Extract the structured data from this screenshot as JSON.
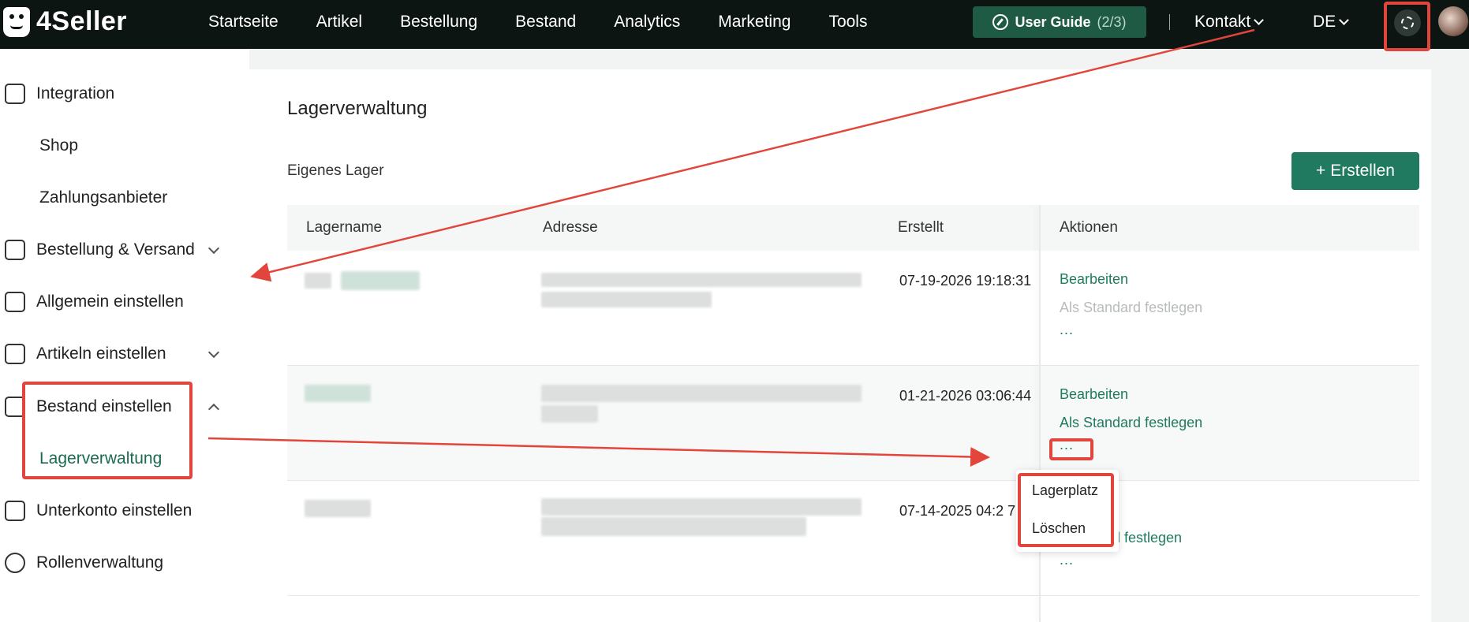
{
  "app": {
    "logo_text": "4Seller"
  },
  "nav": {
    "items": [
      "Startseite",
      "Artikel",
      "Bestellung",
      "Bestand",
      "Analytics",
      "Marketing",
      "Tools"
    ],
    "user_guide_label": "User Guide",
    "user_guide_count": "(2/3)",
    "kontakt_label": "Kontakt",
    "language": "DE"
  },
  "sidebar": {
    "integration": "Integration",
    "shop": "Shop",
    "zahlungsanbieter": "Zahlungsanbieter",
    "bestellung_versand": "Bestellung & Versand",
    "allgemein": "Allgemein einstellen",
    "artikeln": "Artikeln einstellen",
    "bestand": "Bestand einstellen",
    "lagerverwaltung": "Lagerverwaltung",
    "unterkonto": "Unterkonto einstellen",
    "rollen": "Rollenverwaltung"
  },
  "main": {
    "title": "Lagerverwaltung",
    "section_label": "Eigenes Lager",
    "create_button": "Erstellen",
    "columns": [
      "Lagername",
      "Adresse",
      "Erstellt",
      "Aktionen"
    ],
    "rows": [
      {
        "created": "07-19-2026 19:18:31",
        "edit": "Bearbeiten",
        "set_default": "Als Standard festlegen",
        "more": "..."
      },
      {
        "created": "01-21-2026 03:06:44",
        "edit": "Bearbeiten",
        "set_default": "Als Standard festlegen",
        "more": "..."
      },
      {
        "created": "07-14-2025 04:2 7",
        "edit": "en",
        "set_default": "lard festlegen",
        "more": "..."
      }
    ]
  },
  "dropdown": {
    "items": [
      "Lagerplatz",
      "Löschen"
    ]
  },
  "colors": {
    "accent": "#1f7a5f",
    "topbar": "#0d1512",
    "annotation": "#e2453b"
  }
}
